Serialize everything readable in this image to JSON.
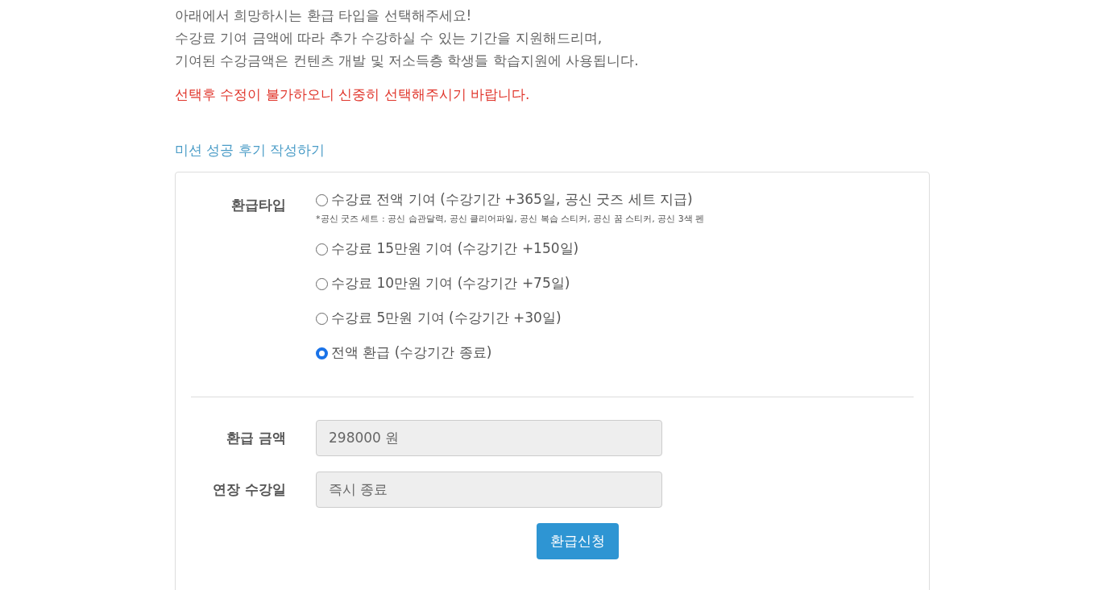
{
  "intro": [
    "아래에서 희망하시는 환급 타입을 선택해주세요!",
    "수강료 기여 금액에 따라 추가 수강하실 수 있는 기간을 지원해드리며,",
    "기여된 수강금액은 컨텐츠 개발 및 저소득층 학생들 학습지원에 사용됩니다."
  ],
  "warning": "선택후 수정이 불가하오니 신중히 선택해주시기 바랍니다.",
  "review_link": "미션 성공 후기 작성하기",
  "refund_type": {
    "label": "환급타입",
    "options": [
      {
        "label": "수강료 전액 기여 (수강기간 +365일, 공신 굿즈 세트 지급)",
        "note": "*공신 굿즈 세트 : 공신 습관달력, 공신 클리어파일, 공신 복습 스티커, 공신 꿈 스티커, 공신 3색 펜",
        "selected": false
      },
      {
        "label": "수강료 15만원 기여 (수강기간 +150일)",
        "selected": false
      },
      {
        "label": "수강료 10만원 기여 (수강기간 +75일)",
        "selected": false
      },
      {
        "label": "수강료 5만원 기여 (수강기간 +30일)",
        "selected": false
      },
      {
        "label": "전액 환급 (수강기간 종료)",
        "selected": true
      }
    ]
  },
  "fields": [
    {
      "label": "환급 금액",
      "value": "298000 원"
    },
    {
      "label": "연장 수강일",
      "value": "즉시 종료"
    }
  ],
  "submit_button": "환급신청"
}
